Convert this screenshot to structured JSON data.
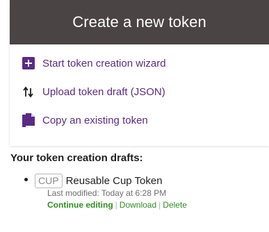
{
  "header": {
    "title": "Create a new token"
  },
  "actions": [
    {
      "label": "Start token creation wizard",
      "icon": "plus-square-icon"
    },
    {
      "label": "Upload token draft (JSON)",
      "icon": "upload-arrows-icon"
    },
    {
      "label": "Copy an existing token",
      "icon": "copy-file-icon"
    }
  ],
  "drafts": {
    "heading": "Your token creation drafts:",
    "items": [
      {
        "symbol": "CUP",
        "name": "Reusable Cup Token",
        "modified": "Last modified: Today at 6:28 PM",
        "continue_label": "Continue editing",
        "download_label": "Download",
        "delete_label": "Delete",
        "separator": "|"
      }
    ]
  },
  "colors": {
    "header_bg": "#4a4444",
    "accent_purple": "#5b2a86",
    "link_green": "#2c8f1f"
  }
}
